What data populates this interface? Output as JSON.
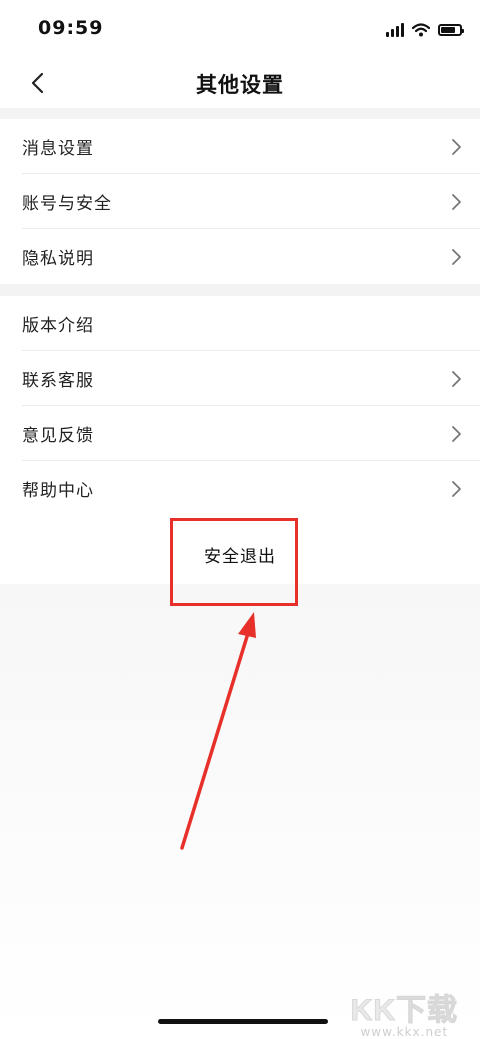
{
  "status_bar": {
    "time": "09:59"
  },
  "header": {
    "title": "其他设置"
  },
  "groups": [
    {
      "items": [
        {
          "label": "消息设置"
        },
        {
          "label": "账号与安全"
        },
        {
          "label": "隐私说明"
        }
      ]
    },
    {
      "items": [
        {
          "label": "版本介绍"
        },
        {
          "label": "联系客服"
        },
        {
          "label": "意见反馈"
        },
        {
          "label": "帮助中心"
        }
      ]
    }
  ],
  "logout": {
    "label": "安全退出"
  },
  "watermark": {
    "logo": "KK下载",
    "url": "www.kkx.net"
  },
  "colors": {
    "highlight": "#e8302a",
    "background": "#f3f3f3"
  },
  "icons": [
    "back-chevron-icon",
    "chevron-right-icon",
    "signal-icon",
    "wifi-icon",
    "battery-icon",
    "annotation-arrow-icon"
  ]
}
